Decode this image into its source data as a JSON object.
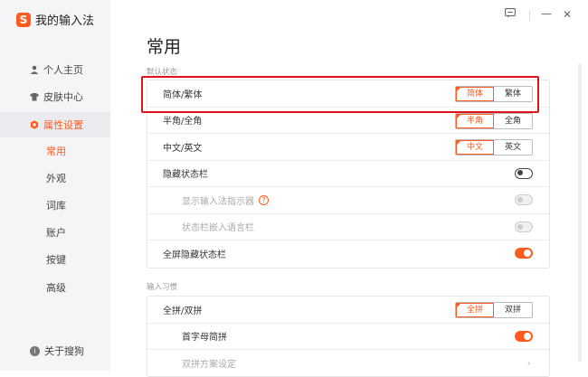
{
  "app": {
    "logo_letter": "S",
    "name": "我的输入法"
  },
  "window_controls": {
    "feedback_icon": "message-icon",
    "minimize": "—",
    "close": "✕"
  },
  "sidebar": {
    "items": [
      {
        "label": "个人主页",
        "icon": "person-icon"
      },
      {
        "label": "皮肤中心",
        "icon": "shirt-icon"
      },
      {
        "label": "属性设置",
        "icon": "settings-icon",
        "active": true
      }
    ],
    "subitems": [
      {
        "label": "常用",
        "active": true
      },
      {
        "label": "外观"
      },
      {
        "label": "词库"
      },
      {
        "label": "账户"
      },
      {
        "label": "按键"
      },
      {
        "label": "高级"
      }
    ],
    "about": {
      "label": "关于搜狗",
      "icon": "info-icon"
    }
  },
  "main": {
    "title": "常用",
    "sections": [
      {
        "label": "默认状态",
        "rows": [
          {
            "label": "简体/繁体",
            "type": "segmented",
            "options": [
              "简体",
              "繁体"
            ],
            "selected": 0
          },
          {
            "label": "半角/全角",
            "type": "segmented",
            "options": [
              "半角",
              "全角"
            ],
            "selected": 0
          },
          {
            "label": "中文/英文",
            "type": "segmented",
            "options": [
              "中文",
              "英文"
            ],
            "selected": 0
          },
          {
            "label": "隐藏状态栏",
            "type": "toggle",
            "state": "off"
          },
          {
            "label": "显示输入法指示器",
            "type": "toggle",
            "state": "disabled",
            "help": "?"
          },
          {
            "label": "状态栏嵌入语言栏",
            "type": "toggle",
            "state": "disabled"
          },
          {
            "label": "全屏隐藏状态栏",
            "type": "toggle",
            "state": "on"
          }
        ]
      },
      {
        "label": "输入习惯",
        "rows": [
          {
            "label": "全拼/双拼",
            "type": "segmented",
            "options": [
              "全拼",
              "双拼"
            ],
            "selected": 0
          },
          {
            "label": "首字母简拼",
            "type": "toggle",
            "state": "on"
          },
          {
            "label": "双拼方案设定",
            "type": "link",
            "chevron": "›"
          }
        ]
      }
    ]
  },
  "colors": {
    "accent": "#ff5a1f",
    "highlight_box": "#e0121a"
  }
}
